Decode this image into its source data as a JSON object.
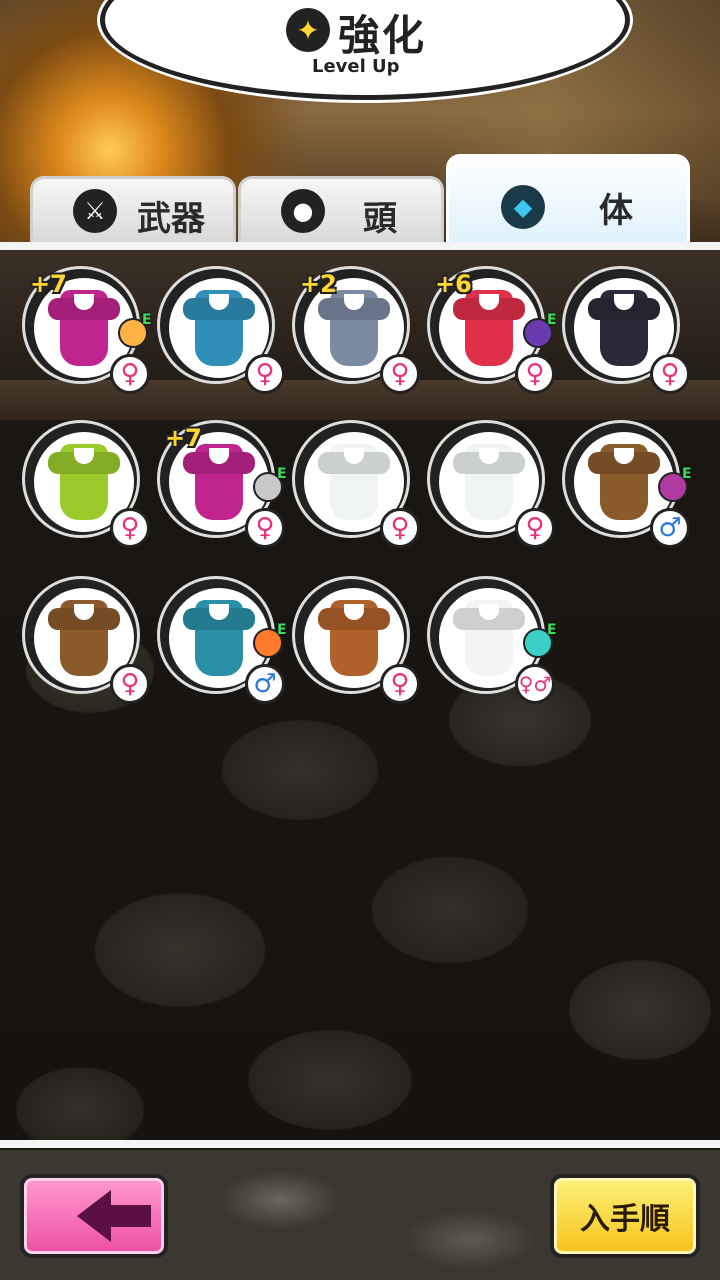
{
  "header": {
    "title": "強化",
    "subtitle": "Level Up",
    "icon": "sparkle-icon"
  },
  "tabs": [
    {
      "label": "武器",
      "icon": "sword-icon",
      "active": false
    },
    {
      "label": "頭",
      "icon": "head-icon",
      "active": false
    },
    {
      "label": "体",
      "icon": "body-icon",
      "active": true
    }
  ],
  "items": [
    {
      "plus": "+7",
      "color": "#c0258f",
      "sex": "♀",
      "face": "#ffb347",
      "e": "E"
    },
    {
      "plus": "",
      "color": "#2f8fb8",
      "sex": "♀",
      "face": "",
      "e": ""
    },
    {
      "plus": "+2",
      "color": "#7a8aa0",
      "sex": "♀",
      "face": "",
      "e": ""
    },
    {
      "plus": "+6",
      "color": "#e0304a",
      "sex": "♀",
      "face": "#6a3ab0",
      "e": "E"
    },
    {
      "plus": "",
      "color": "#2a2a3a",
      "sex": "♀",
      "face": "",
      "e": ""
    },
    {
      "plus": "",
      "color": "#9acb2a",
      "sex": "♀",
      "face": "",
      "e": ""
    },
    {
      "plus": "+7",
      "color": "#c0258f",
      "sex": "♀",
      "face": "#c8c8c8",
      "e": "E"
    },
    {
      "plus": "",
      "color": "#f0f4f4",
      "sex": "♀",
      "face": "",
      "e": ""
    },
    {
      "plus": "",
      "color": "#f0f4f4",
      "sex": "♀",
      "face": "",
      "e": ""
    },
    {
      "plus": "",
      "color": "#8a5a2a",
      "sex": "♂",
      "face": "#b03aa0",
      "e": "E"
    },
    {
      "plus": "",
      "color": "#8a5a2a",
      "sex": "♀",
      "face": "",
      "e": ""
    },
    {
      "plus": "",
      "color": "#2a90a8",
      "sex": "♂",
      "face": "#ff7a2a",
      "e": "E"
    },
    {
      "plus": "",
      "color": "#b0602a",
      "sex": "♀",
      "face": "",
      "e": ""
    },
    {
      "plus": "",
      "color": "#f4f4f4",
      "sex": "♀♂",
      "face": "#3ad0c8",
      "e": "E"
    }
  ],
  "footer": {
    "back_icon": "back-arrow-icon",
    "sort_label": "入手順"
  }
}
